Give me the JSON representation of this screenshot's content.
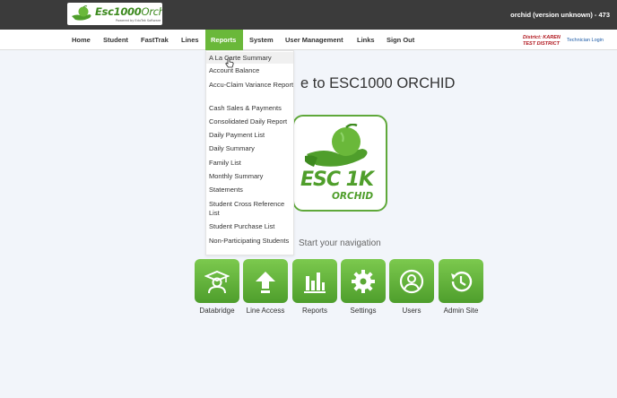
{
  "header": {
    "logo": {
      "brand_bold": "Esc1000",
      "brand_light": "Orchid",
      "powered_by": "Powered by EduTek Software"
    },
    "version_text": "orchid (version unknown) - 473"
  },
  "nav": {
    "items": [
      {
        "label": "Home"
      },
      {
        "label": "Student"
      },
      {
        "label": "FastTrak"
      },
      {
        "label": "Lines"
      },
      {
        "label": "Reports",
        "active": true
      },
      {
        "label": "System"
      },
      {
        "label": "User Management"
      },
      {
        "label": "Links"
      },
      {
        "label": "Sign Out"
      }
    ],
    "district_line1": "District: KAREN",
    "district_line2": "TEST DISTRICT",
    "technician_login": "Technician Login"
  },
  "reports_menu": {
    "items": [
      "A La Carte Summary",
      "Account Balance",
      "Accu-Claim Variance Report",
      "Cash Sales & Payments",
      "Consolidated Daily Report",
      "Daily Payment List",
      "Daily Summary",
      "Family List",
      "Monthly Summary",
      "Statements",
      "Student Cross Reference List",
      "Student Purchase List",
      "Non-Participating Students"
    ]
  },
  "main": {
    "welcome_text": "e to ESC1000 ORCHID",
    "big_logo": {
      "esc": "ESC 1K",
      "orchid": "ORCHID"
    },
    "start_nav_text": "Start your navigation",
    "tiles": [
      {
        "label": "Databridge",
        "icon": "graduate-icon"
      },
      {
        "label": "Line Access",
        "icon": "upload-icon"
      },
      {
        "label": "Reports",
        "icon": "bar-chart-icon"
      },
      {
        "label": "Settings",
        "icon": "gear-icon"
      },
      {
        "label": "Users",
        "icon": "user-icon"
      },
      {
        "label": "Admin Site",
        "icon": "history-icon"
      }
    ]
  },
  "colors": {
    "topbar": "#3b3b3b",
    "accent_green": "#6ab83a",
    "tile_green": "#5aa834",
    "district_red": "#b0161d",
    "link_blue": "#1c5aa6"
  }
}
